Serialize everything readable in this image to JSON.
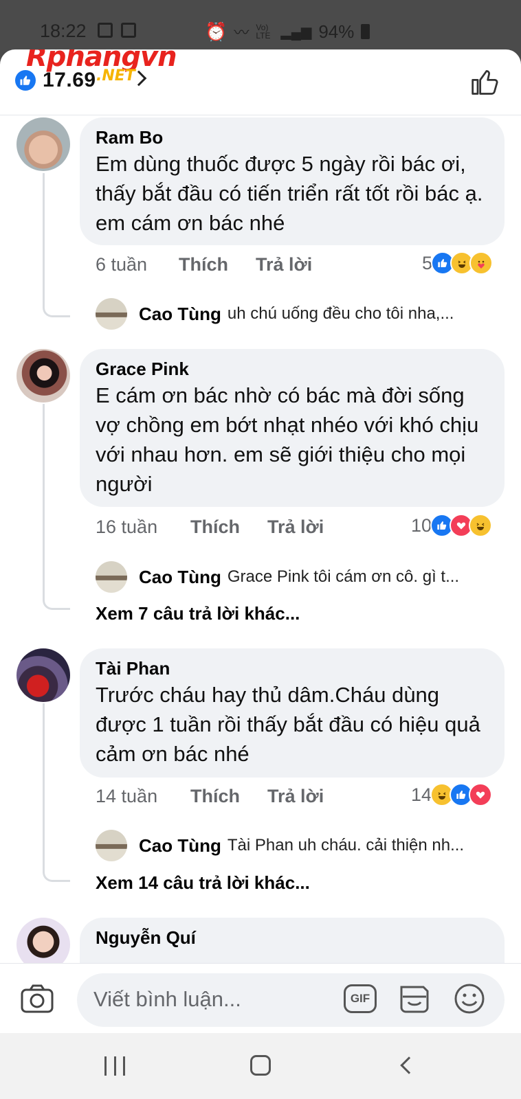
{
  "status_bar": {
    "time": "18:22",
    "network": "Vo) LTE",
    "battery": "94%"
  },
  "header": {
    "like_count": "17.69",
    "watermark": "Rphangvn",
    "watermark_suffix": ".NET"
  },
  "comments": [
    {
      "name": "Ram Bo",
      "text": "Em dùng thuốc được 5 ngày rồi bác ơi, thấy bắt đầu có tiến triển rất tốt rồi bác ạ. em cám ơn bác nhé",
      "time": "6 tuần",
      "like_label": "Thích",
      "reply_label": "Trả lời",
      "reaction_count": "5",
      "reactions": [
        "like",
        "haha",
        "care"
      ],
      "reply": {
        "name": "Cao Tùng",
        "text": "uh chú uống đều cho tôi nha,..."
      }
    },
    {
      "name": "Grace Pink",
      "text": "E cám ơn bác nhờ có bác mà đời sống vợ chồng em bớt nhạt nhéo với khó chịu với nhau hơn. em sẽ giới thiệu cho mọi người",
      "time": "16 tuần",
      "like_label": "Thích",
      "reply_label": "Trả lời",
      "reaction_count": "10",
      "reactions": [
        "like",
        "love",
        "haha"
      ],
      "reply": {
        "name": "Cao Tùng",
        "text": "Grace Pink tôi cám ơn cô. gì t..."
      },
      "more_replies": "Xem 7 câu trả lời khác..."
    },
    {
      "name": "Tài Phan",
      "text": "Trước cháu hay thủ dâm.Cháu dùng được 1 tuần rồi thấy bắt đầu có hiệu quả cảm ơn bác nhé",
      "time": "14 tuần",
      "like_label": "Thích",
      "reply_label": "Trả lời",
      "reaction_count": "14",
      "reactions": [
        "haha",
        "like",
        "love"
      ],
      "reply": {
        "name": "Cao Tùng",
        "text": "Tài Phan uh cháu. cải thiện nh..."
      },
      "more_replies": "Xem 14 câu trả lời khác..."
    },
    {
      "name": "Nguyễn Quí"
    }
  ],
  "composer": {
    "placeholder": "Viết bình luận...",
    "gif_label": "GIF"
  },
  "colors": {
    "accent": "#1877f2",
    "love": "#f33e58",
    "haha": "#f7c12f",
    "bubble": "#f0f2f5",
    "muted": "#65676b"
  }
}
